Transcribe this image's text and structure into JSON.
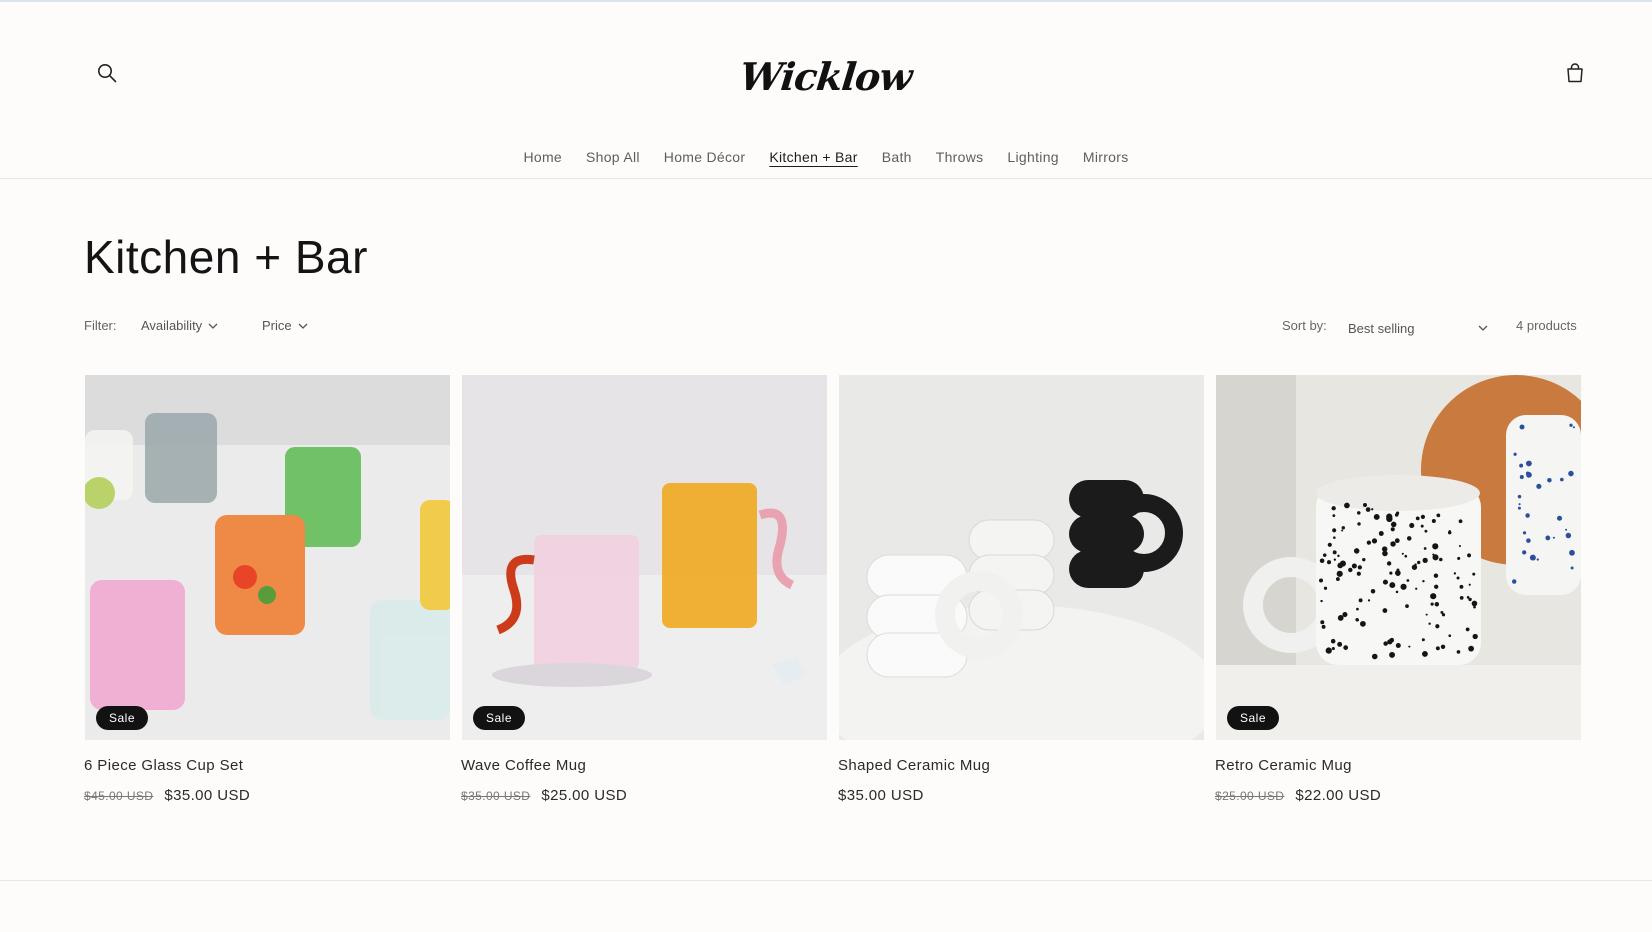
{
  "brand": {
    "logo_text": "Wicklow"
  },
  "nav": {
    "items": [
      {
        "label": "Home",
        "active": false
      },
      {
        "label": "Shop All",
        "active": false
      },
      {
        "label": "Home Décor",
        "active": false
      },
      {
        "label": "Kitchen + Bar",
        "active": true
      },
      {
        "label": "Bath",
        "active": false
      },
      {
        "label": "Throws",
        "active": false
      },
      {
        "label": "Lighting",
        "active": false
      },
      {
        "label": "Mirrors",
        "active": false
      }
    ]
  },
  "page": {
    "title": "Kitchen + Bar"
  },
  "filters": {
    "label": "Filter:",
    "availability": "Availability",
    "price": "Price",
    "sort_label": "Sort by:",
    "sort_value": "Best selling",
    "count": "4 products"
  },
  "products": [
    {
      "title": "6 Piece Glass Cup Set",
      "was": "$45.00 USD",
      "price": "$35.00 USD",
      "badge": "Sale"
    },
    {
      "title": "Wave Coffee Mug",
      "was": "$35.00 USD",
      "price": "$25.00 USD",
      "badge": "Sale"
    },
    {
      "title": "Shaped Ceramic Mug",
      "was": "",
      "price": "$35.00 USD",
      "badge": ""
    },
    {
      "title": "Retro Ceramic Mug",
      "was": "$25.00 USD",
      "price": "$22.00 USD",
      "badge": "Sale"
    }
  ],
  "icons": {
    "search": "search-icon",
    "cart": "cart-icon",
    "chevron": "chevron-down-icon"
  },
  "colors": {
    "background": "#fdfcfb",
    "badge": "#121212",
    "text": "#222222"
  }
}
